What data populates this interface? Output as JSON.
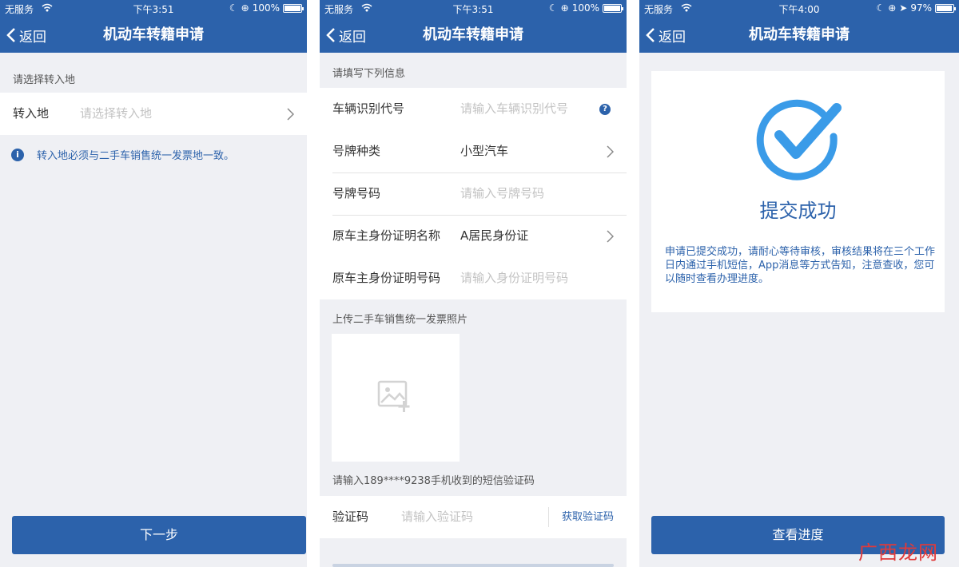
{
  "screen1": {
    "status": {
      "carrier": "无服务",
      "time": "下午3:51",
      "battery": "100%"
    },
    "nav": {
      "back": "返回",
      "title": "机动车转籍申请"
    },
    "section_label": "请选择转入地",
    "field": {
      "label": "转入地",
      "placeholder": "请选择转入地"
    },
    "notice": "转入地必须与二手车销售统一发票地一致。",
    "next_button": "下一步"
  },
  "screen2": {
    "status": {
      "carrier": "无服务",
      "time": "下午3:51",
      "battery": "100%"
    },
    "nav": {
      "back": "返回",
      "title": "机动车转籍申请"
    },
    "section_label": "请填写下列信息",
    "fields": [
      {
        "label": "车辆识别代号",
        "placeholder": "请输入车辆识别代号"
      },
      {
        "label": "号牌种类",
        "value": "小型汽车"
      },
      {
        "label": "号牌号码",
        "placeholder": "请输入号牌号码"
      },
      {
        "label": "原车主身份证明名称",
        "value": "A居民身份证"
      },
      {
        "label": "原车主身份证明号码",
        "placeholder": "请输入身份证明号码"
      }
    ],
    "help_icon": "?",
    "upload_label": "上传二手车销售统一发票照片",
    "sms_label": "请输入189****9238手机收到的短信验证码",
    "code": {
      "label": "验证码",
      "placeholder": "请输入验证码",
      "get_button": "获取验证码"
    }
  },
  "screen3": {
    "status": {
      "carrier": "无服务",
      "time": "下午4:00",
      "battery": "97%"
    },
    "nav": {
      "back": "返回",
      "title": "机动车转籍申请"
    },
    "success_title": "提交成功",
    "message": "申请已提交成功，请耐心等待审核，审核结果将在三个工作日内通过手机短信，App消息等方式告知，注意查收，您可以随时查看办理进度。",
    "progress_button": "查看进度"
  },
  "watermark": "广西龙网",
  "colors": {
    "primary": "#2c62ab",
    "check": "#3a9be8",
    "background": "#eff0f4"
  }
}
